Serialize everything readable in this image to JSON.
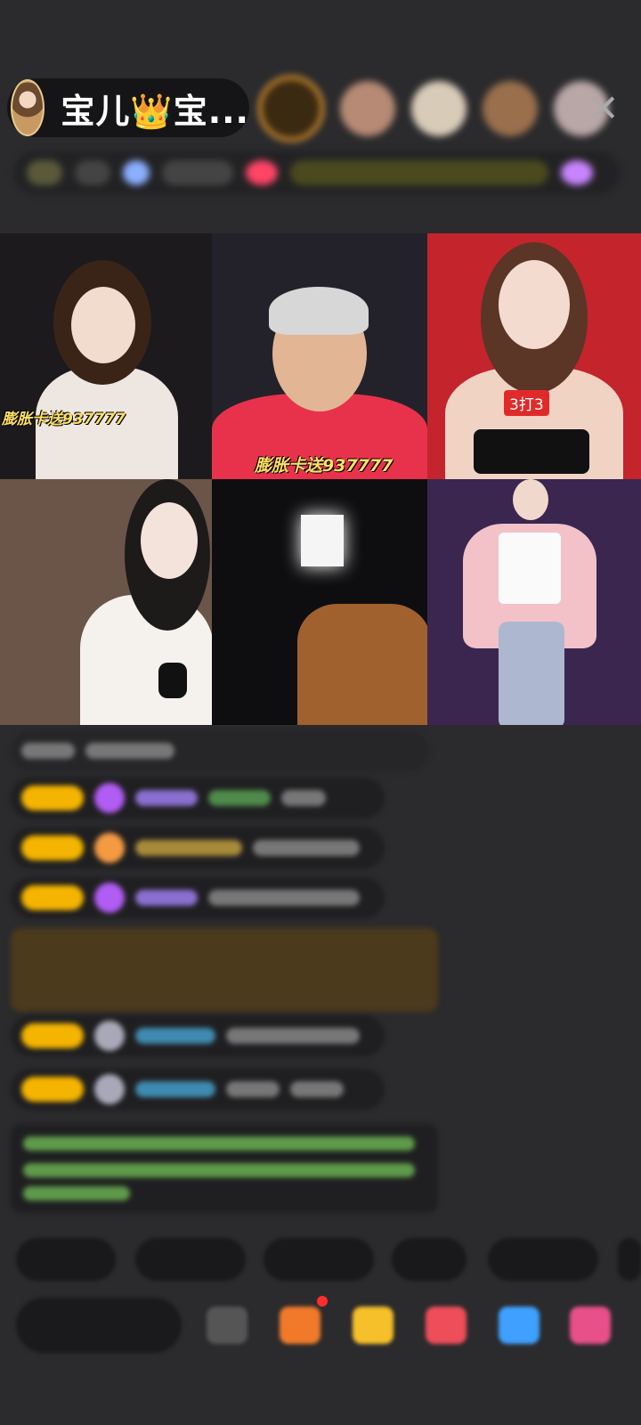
{
  "host": {
    "name": "宝儿👑宝...",
    "avatar_icon": "host-avatar-icon"
  },
  "top_bar": {
    "close_icon": "✕"
  },
  "viewers": [
    {
      "color": "#c47a2c"
    },
    {
      "color": "#b68a74"
    },
    {
      "color": "#d8cbb8"
    },
    {
      "color": "#9a6f4c"
    },
    {
      "color": "#b9a6a6"
    }
  ],
  "grid": {
    "cells": [
      {
        "name": "guest-1",
        "overlay": "膨胀卡送937777",
        "bg": "#1c1a1c"
      },
      {
        "name": "guest-2",
        "overlay": "膨胀卡送937777",
        "bg": "#23222a"
      },
      {
        "name": "guest-3",
        "badge": "3打3",
        "bg": "#c4242c"
      },
      {
        "name": "guest-4",
        "bg": "#6b5548"
      },
      {
        "name": "guest-5",
        "bg": "#0e0e10"
      },
      {
        "name": "guest-6",
        "bg": "#3b2650"
      }
    ]
  },
  "colors": {
    "badge": "#f4b400",
    "accent_purple": "#b15cf2",
    "accent_orange": "#f49a42",
    "gift_bg": "#4b3a1c"
  }
}
